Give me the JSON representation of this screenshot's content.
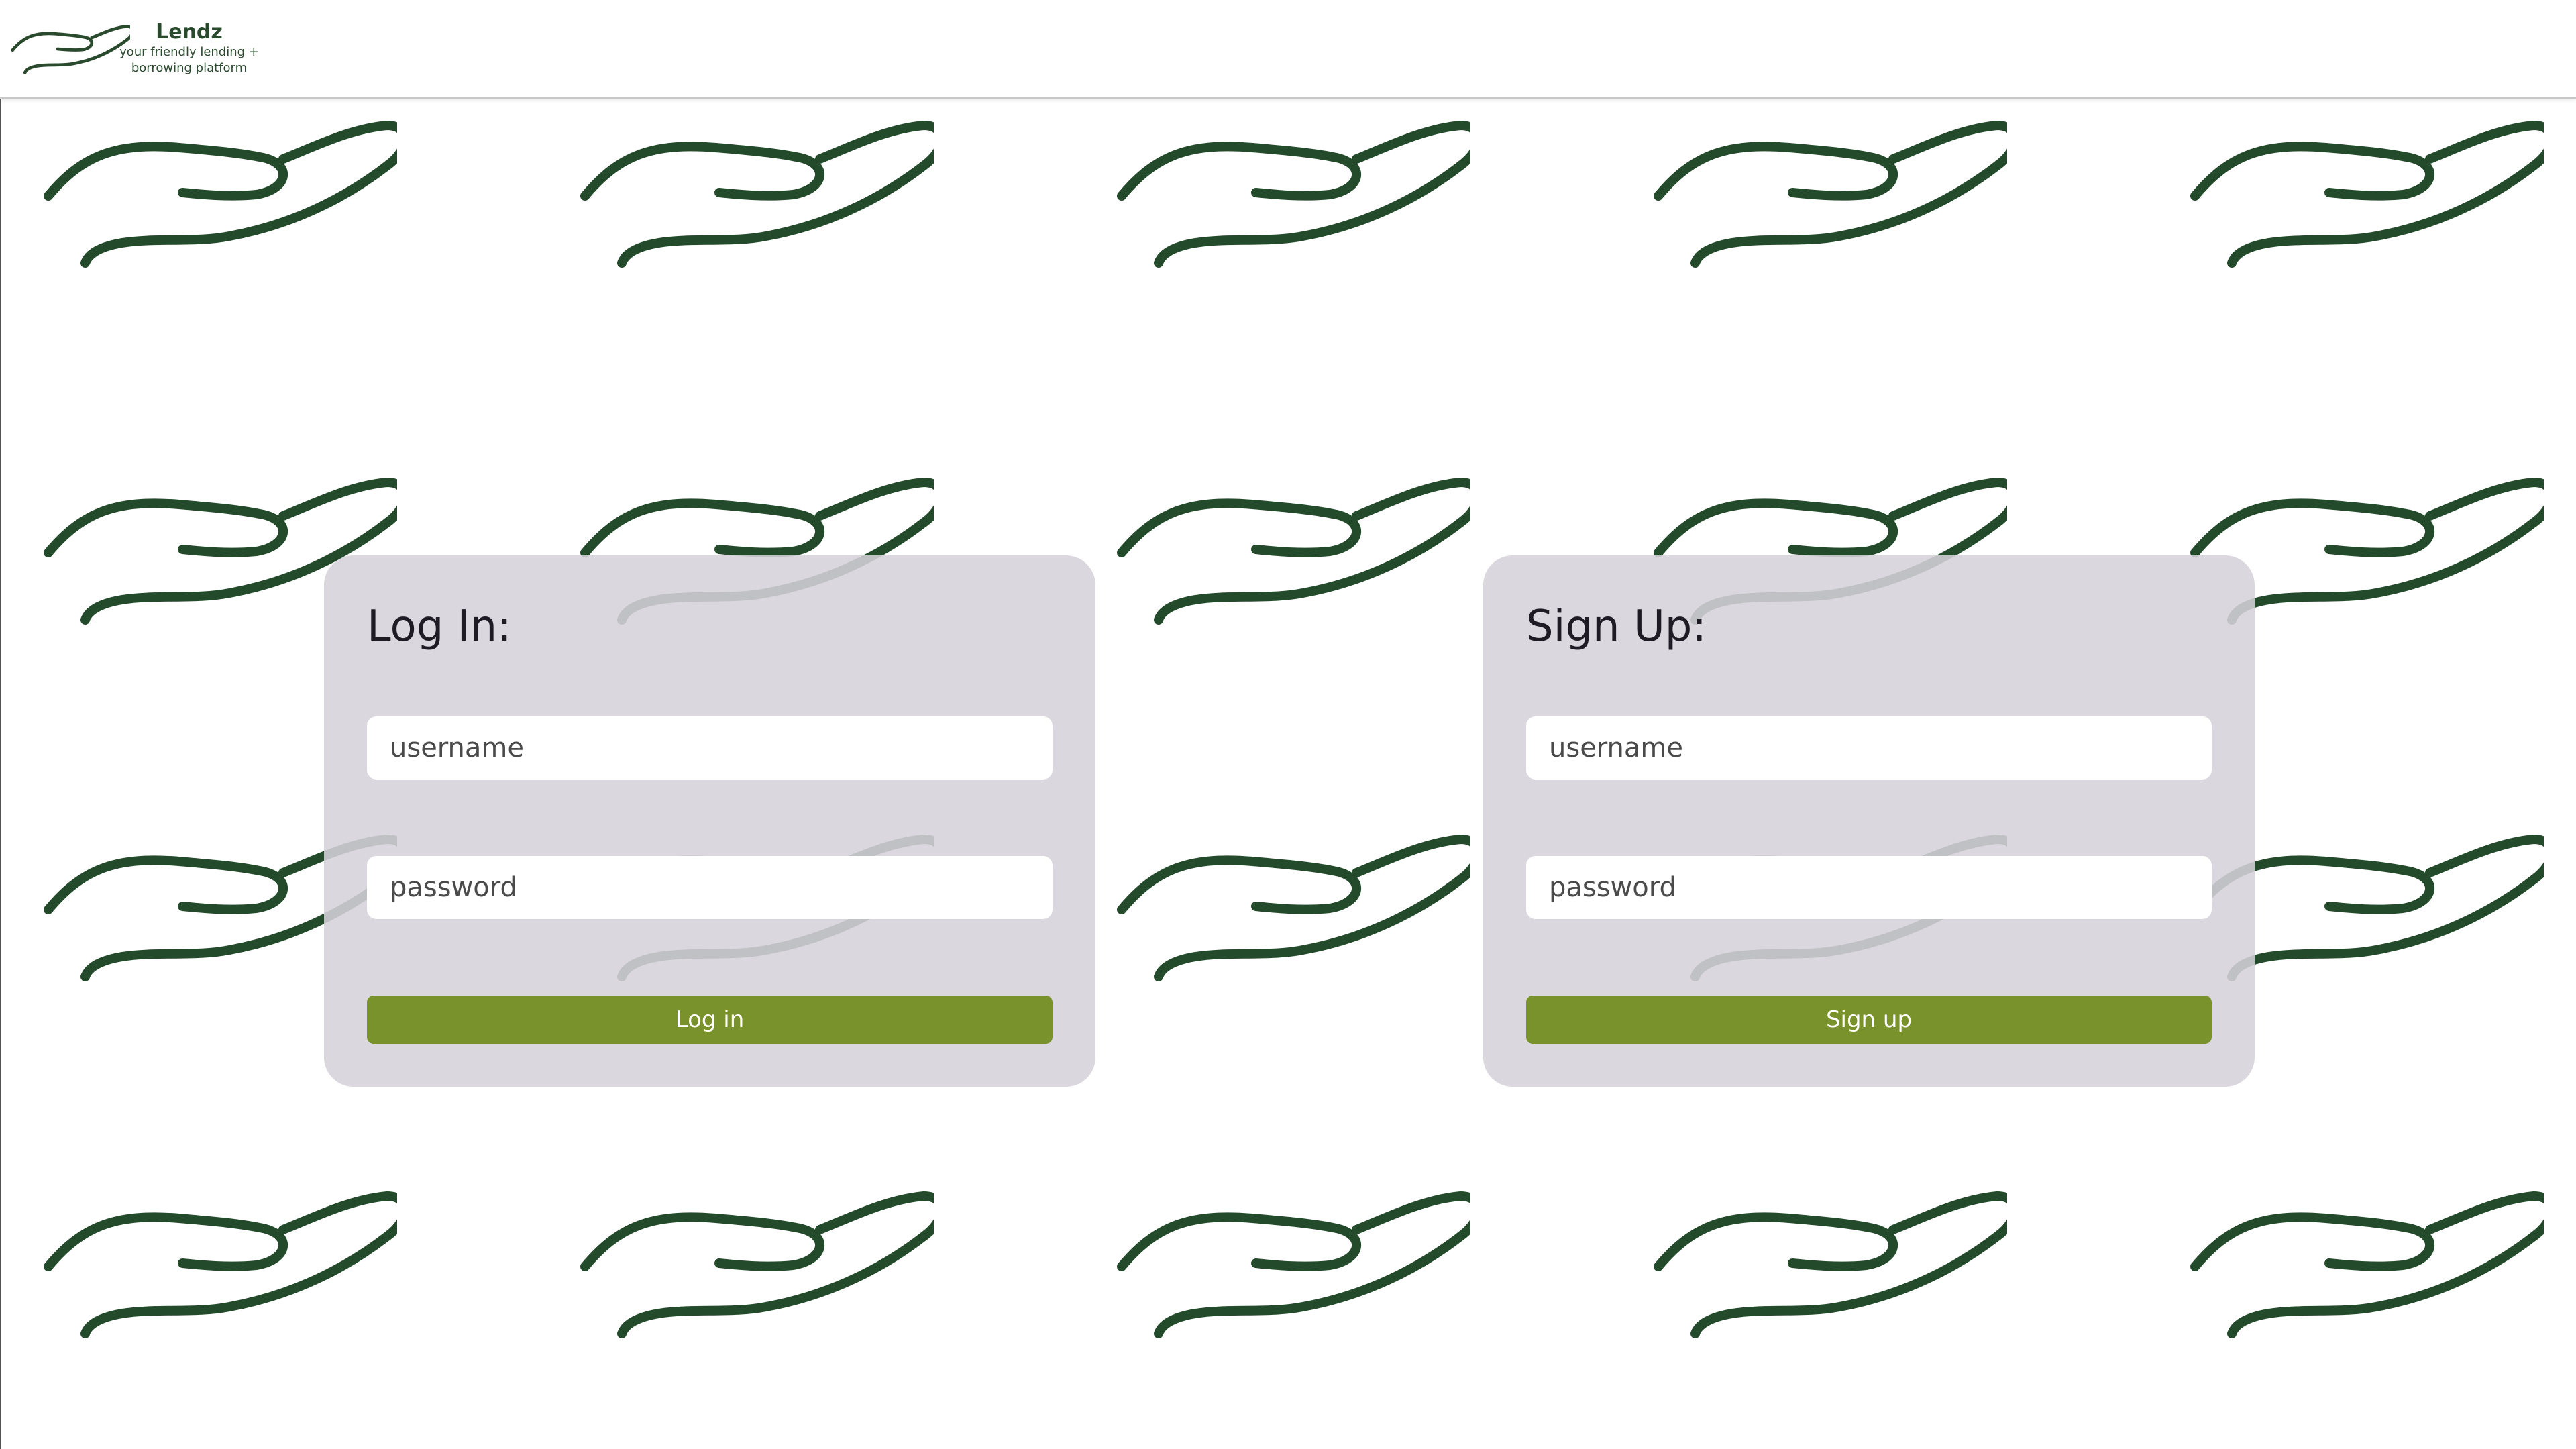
{
  "brand": {
    "name": "Lendz",
    "tagline": "your friendly lending + borrowing platform",
    "logo_icon": "open-hand-icon"
  },
  "colors": {
    "brand_green": "#2a4a2e",
    "hand_green": "#234a2a",
    "button_green": "#7a922c",
    "card_background": "#d6d1da"
  },
  "background": {
    "pattern_icon": "open-hand-icon"
  },
  "login": {
    "title": "Log In:",
    "username_placeholder": "username",
    "password_placeholder": "password",
    "button_label": "Log in"
  },
  "signup": {
    "title": "Sign Up:",
    "username_placeholder": "username",
    "password_placeholder": "password",
    "button_label": "Sign up"
  }
}
